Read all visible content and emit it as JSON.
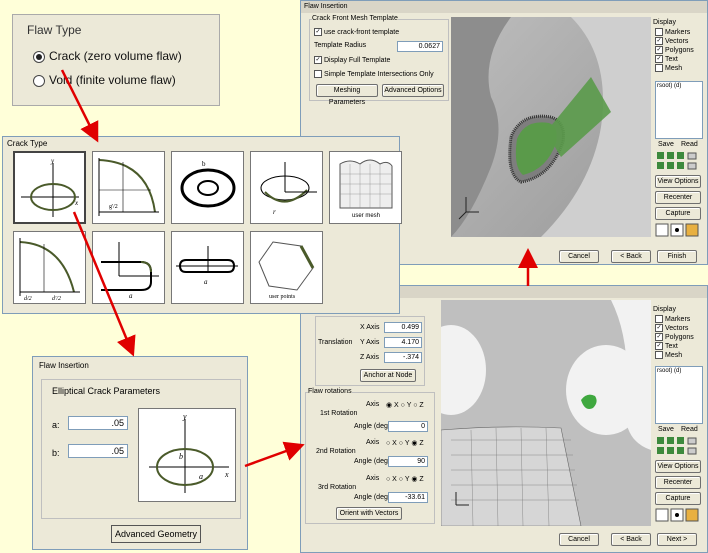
{
  "flaw_type": {
    "title": "Flaw Type",
    "options": [
      "Crack (zero volume flaw)",
      "Void (finite volume flaw)"
    ],
    "selected": 0
  },
  "crack_type": {
    "title": "Crack Type",
    "user_mesh_label": "user mesh",
    "user_points_label": "user points",
    "cells": [
      {
        "name": "elliptical"
      },
      {
        "name": "quarter-elliptical-corner"
      },
      {
        "name": "embedded-ring"
      },
      {
        "name": "surface-crack"
      },
      {
        "name": "user-mesh"
      },
      {
        "name": "through-edge"
      },
      {
        "name": "through-hole-edge"
      },
      {
        "name": "through-slot"
      },
      {
        "name": "user-points"
      }
    ],
    "labels": {
      "y": "y",
      "x": "x",
      "a": "a",
      "b": "b",
      "c": "c",
      "d": "d",
      "r": "r",
      "t": "t",
      "d2": "d/2",
      "g2": "g'/2",
      "dp": "d'/2"
    }
  },
  "flaw_insertion_small": {
    "title": "Flaw Insertion",
    "group_title": "Elliptical Crack Parameters",
    "a_label": "a:",
    "a_value": ".05",
    "b_label": "b:",
    "b_value": ".05",
    "button": "Advanced Geometry"
  },
  "top_dialog": {
    "title": "Flaw Insertion",
    "group_title": "Crack Front Mesh Template",
    "use_template": "use crack-front template",
    "template_radius_label": "Template Radius",
    "template_radius_value": "0.0627",
    "display_full": "Display Full Template",
    "simple_template": "Simple Template Intersections Only",
    "meshing_btn": "Meshing Parameters",
    "advanced_btn": "Advanced Options",
    "cancel": "Cancel",
    "back": "< Back",
    "finish": "Finish"
  },
  "display_panel": {
    "title": "Display",
    "items": [
      "Markers",
      "Vectors",
      "Polygons",
      "Text",
      "Mesh"
    ],
    "checked": [
      false,
      true,
      true,
      true,
      false
    ],
    "list_item": "rsoot) (d)",
    "save": "Save",
    "read": "Read",
    "view_options": "View Options",
    "recenter": "Recenter",
    "capture": "Capture"
  },
  "bottom_dialog": {
    "x_axis_label": "X Axis",
    "x_axis_value": "0.499",
    "translation_label": "Translation",
    "y_axis_label": "Y Axis",
    "y_axis_value": "4.170",
    "z_axis_label": "Z Axis",
    "z_axis_value": "-.374",
    "anchor_btn": "Anchor at Node",
    "flaw_rotations": "Flaw rotations",
    "axis_label": "Axis",
    "axis_opts": "X  Y  Z",
    "angle_label": "Angle (deg)",
    "rot1_label": "1st Rotation",
    "rot1_axis": "X",
    "rot1_angle": "0",
    "rot2_label": "2nd Rotation",
    "rot2_axis": "Z",
    "rot2_angle": "90",
    "rot3_label": "3rd Rotation",
    "rot3_axis": "Z",
    "rot3_angle": "-33.61",
    "orient_btn": "Orient with Vectors",
    "cancel": "Cancel",
    "back": "< Back",
    "next": "Next >"
  },
  "colors": {
    "arrow": "#e00000",
    "crack_green": "#5a9a4a",
    "window": "#ece9d8",
    "background": "#ffffd9"
  }
}
